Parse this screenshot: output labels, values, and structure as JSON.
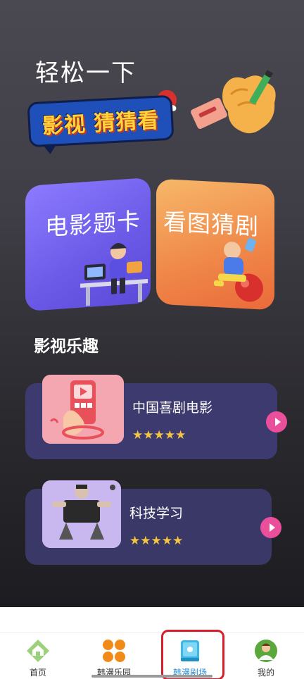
{
  "header": {
    "title": "轻松一下",
    "banner_text": "影视 猜猜看"
  },
  "cards": [
    {
      "label": "电影题卡"
    },
    {
      "label": "看图猜剧"
    }
  ],
  "section": {
    "title": "影视乐趣"
  },
  "list": [
    {
      "title": "中国喜剧电影",
      "stars": "★★★★★",
      "rating": 5
    },
    {
      "title": "科技学习",
      "stars": "★★★★★",
      "rating": 5
    }
  ],
  "bottom_nav": {
    "items": [
      {
        "label": "首页",
        "icon": "home-icon"
      },
      {
        "label": "韩漫乐园",
        "icon": "grid-icon"
      },
      {
        "label": "韩漫剧场",
        "icon": "theater-icon",
        "active": true
      },
      {
        "label": "我的",
        "icon": "profile-icon"
      }
    ],
    "active_color": "#2a8fd6"
  }
}
